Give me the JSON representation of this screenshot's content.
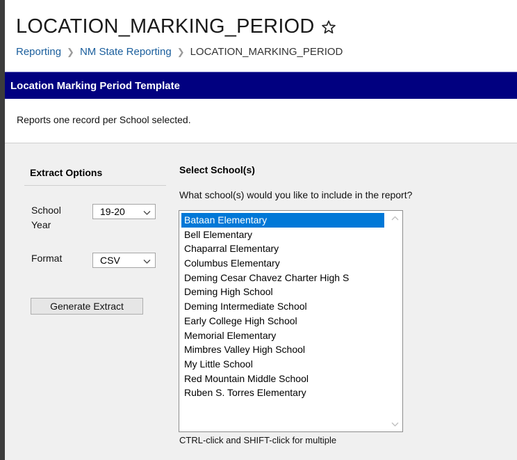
{
  "header": {
    "title": "LOCATION_MARKING_PERIOD",
    "breadcrumb": [
      "Reporting",
      "NM State Reporting",
      "LOCATION_MARKING_PERIOD"
    ]
  },
  "section": {
    "title": "Location Marking Period Template",
    "description": "Reports one record per School selected."
  },
  "extract_options": {
    "heading": "Extract Options",
    "school_year_label_line1": "School",
    "school_year_label_line2": "Year",
    "school_year_value": "19-20",
    "format_label": "Format",
    "format_value": "CSV",
    "generate_button": "Generate Extract"
  },
  "select_schools": {
    "heading": "Select School(s)",
    "question": "What school(s) would you like to include in the report?",
    "schools": [
      "Bataan Elementary",
      "Bell Elementary",
      "Chaparral Elementary",
      "Columbus Elementary",
      "Deming Cesar Chavez Charter High S",
      "Deming High School",
      "Deming Intermediate School",
      "Early College High School",
      "Memorial Elementary",
      "Mimbres Valley High School",
      "My Little School",
      "Red Mountain Middle School",
      "Ruben S. Torres Elementary"
    ],
    "selected_school": "Bataan Elementary",
    "hint": "CTRL-click and SHIFT-click for multiple"
  },
  "colors": {
    "section_bar": "#010080",
    "link": "#1a5e9c",
    "selection": "#0078d7",
    "form_background": "#f0f0f0"
  },
  "icons": [
    "star-icon",
    "chevron-down-icon",
    "chevron-up-icon"
  ]
}
